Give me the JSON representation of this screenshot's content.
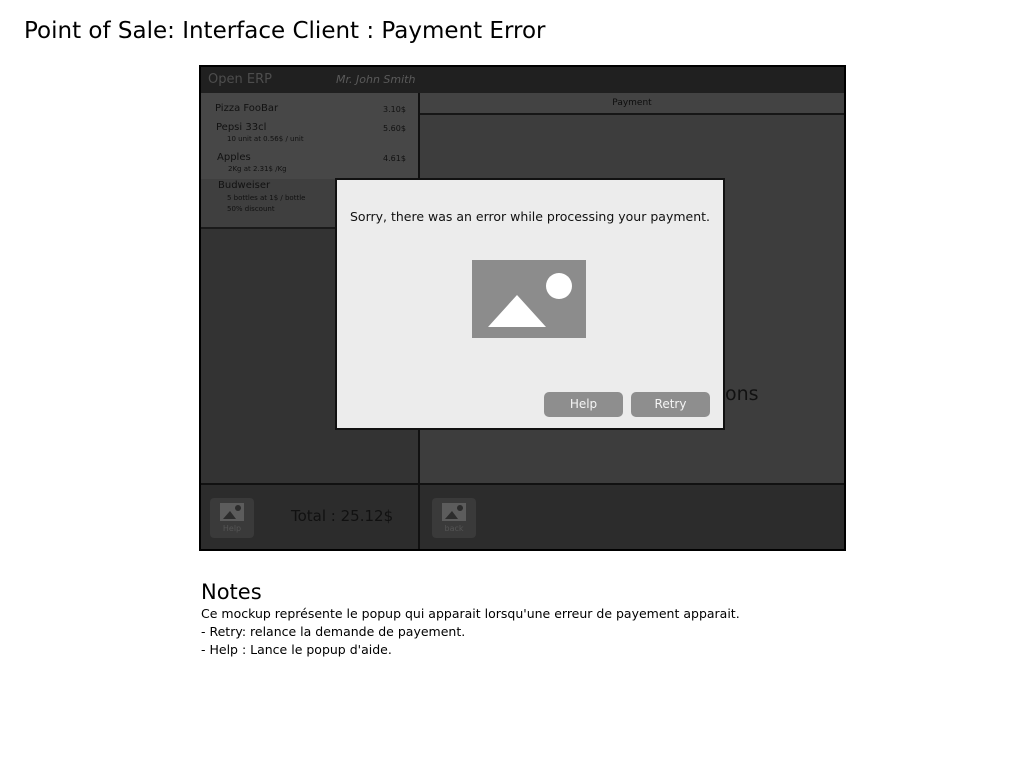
{
  "page": {
    "title": "Point of Sale: Interface Client : Payment Error"
  },
  "header": {
    "brand": "Open ERP",
    "cashier": "Mr. John Smith"
  },
  "order": {
    "lines": [
      {
        "name": "Pizza FooBar",
        "price": "3.10$",
        "details": []
      },
      {
        "name": "Pepsi 33cl",
        "price": "5.60$",
        "details": [
          "10 unit at 0.56$ / unit"
        ]
      },
      {
        "name": "Apples",
        "price": "4.61$",
        "details": [
          "2Kg at 2.31$ /Kg"
        ]
      },
      {
        "name": "Budweiser",
        "price": "",
        "details": [
          "5 bottles at 1$ / bottle",
          "50% discount"
        ]
      }
    ],
    "total": "Total : 25.12$"
  },
  "payment": {
    "header": "Payment",
    "instructions": "card in urther instructions"
  },
  "bottom": {
    "help_label": "Help",
    "back_label": "back"
  },
  "modal": {
    "message": "Sorry, there was an error while processing your payment.",
    "image_icon": "image-placeholder-icon",
    "help_label": "Help",
    "retry_label": "Retry"
  },
  "notes": {
    "title": "Notes",
    "lines": [
      "Ce mockup représente le popup qui apparait lorsqu'une erreur de payement apparait.",
      "- Retry: relance la demande de payement.",
      "- Help : Lance le popup d'aide."
    ]
  },
  "colors": {
    "modal_button": "#8e8e8e",
    "modal_background": "#ececec",
    "screen_background": "#3a3a3a"
  }
}
